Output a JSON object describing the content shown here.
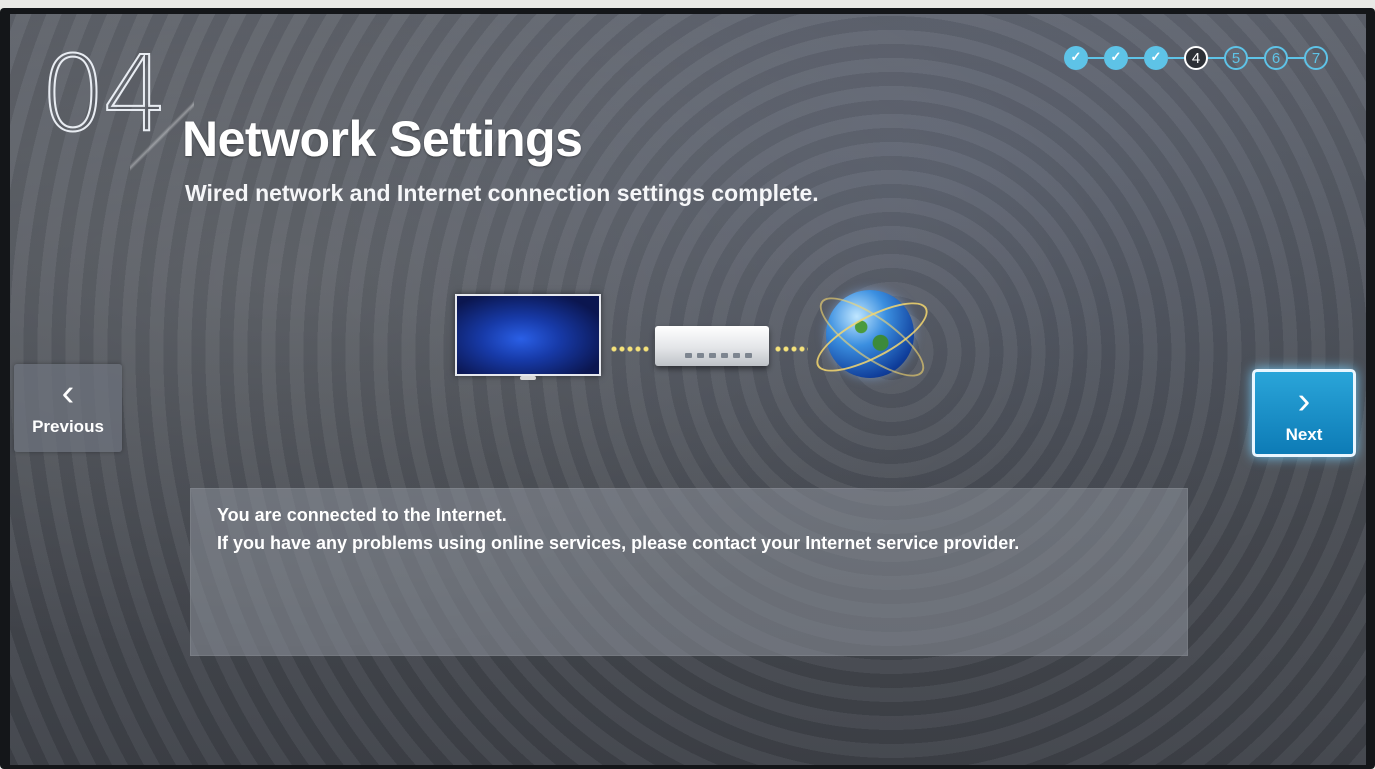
{
  "setup": {
    "step_number": "04",
    "title": "Network Settings",
    "subtitle": "Wired network and Internet connection settings complete.",
    "progress": {
      "current_step": 4,
      "total_steps": 7,
      "steps": [
        {
          "label": "✓",
          "state": "done"
        },
        {
          "label": "✓",
          "state": "done"
        },
        {
          "label": "✓",
          "state": "done"
        },
        {
          "label": "4",
          "state": "current"
        },
        {
          "label": "5",
          "state": "todo"
        },
        {
          "label": "6",
          "state": "todo"
        },
        {
          "label": "7",
          "state": "todo"
        }
      ]
    },
    "diagram": {
      "devices": [
        "tv-icon",
        "router-icon",
        "globe-icon"
      ]
    },
    "nav": {
      "previous_label": "Previous",
      "previous_icon": "chevron-left-icon",
      "next_label": "Next",
      "next_icon": "chevron-right-icon"
    },
    "message": {
      "line1": "You are connected to the Internet.",
      "line2": "If you have any problems using online services, please contact your Internet service provider."
    },
    "colors": {
      "accent": "#5ec3e7",
      "next_button": "#1590c8"
    }
  }
}
